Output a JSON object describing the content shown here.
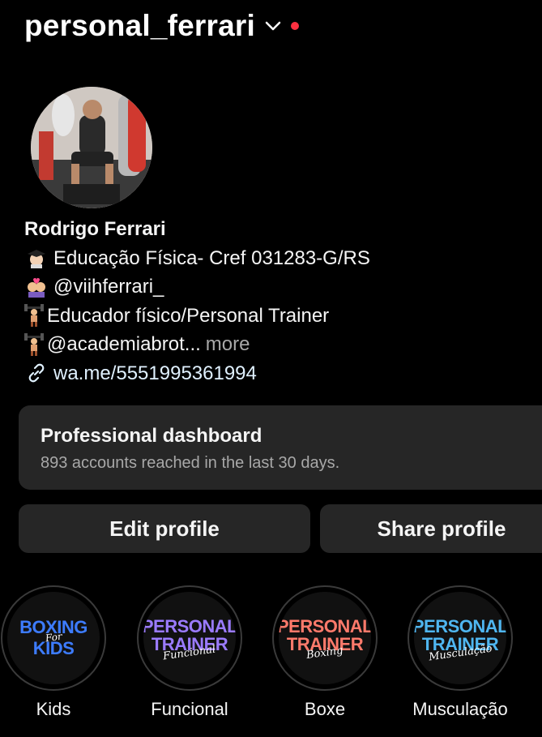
{
  "header": {
    "username": "personal_ferrari",
    "chevron_icon": "chevron-down-icon",
    "notification_dot_color": "#ff3040"
  },
  "profile": {
    "display_name": "Rodrigo Ferrari",
    "bio_lines": [
      {
        "emoji": "graduate-emoji",
        "text": "Educação Física- Cref 031283-G/RS"
      },
      {
        "emoji": "couple-emoji",
        "text": "@viihferrari_"
      },
      {
        "emoji": "weightlifter-emoji",
        "text": "Educador físico/Personal Trainer"
      },
      {
        "emoji": "weightlifter-emoji",
        "text": "@academiabrot...",
        "more": "more"
      }
    ],
    "link": {
      "icon": "link-icon",
      "text": "wa.me/5551995361994"
    }
  },
  "dashboard": {
    "title": "Professional dashboard",
    "subtitle": "893 accounts reached in the last 30 days."
  },
  "buttons": {
    "edit": "Edit profile",
    "share": "Share profile"
  },
  "highlights": [
    {
      "label": "Kids",
      "cover_lines": [
        "BOXING",
        "For",
        "KIDS"
      ],
      "color": "#3d7cff"
    },
    {
      "label": "Funcional",
      "cover_lines": [
        "PERSONAL",
        "TRAINER",
        "Funcional"
      ],
      "color": "#9b7bff"
    },
    {
      "label": "Boxe",
      "cover_lines": [
        "PERSONAL",
        "TRAINER",
        "Boxing"
      ],
      "color": "#ff7a6b"
    },
    {
      "label": "Musculação",
      "cover_lines": [
        "PERSONAL",
        "TRAINER",
        "Musculação"
      ],
      "color": "#4fb6f0"
    }
  ],
  "colors": {
    "background": "#000000",
    "card": "#262626",
    "secondary_text": "#a8a8a8"
  }
}
